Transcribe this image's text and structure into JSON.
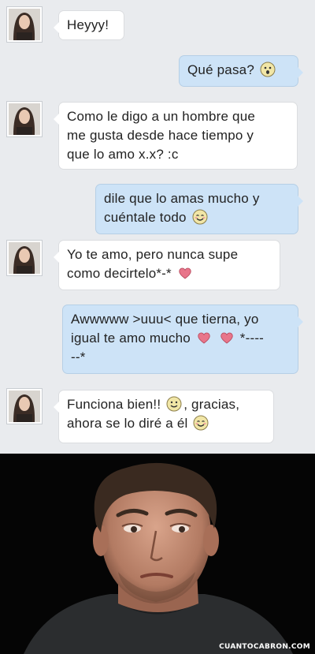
{
  "colors": {
    "chat_background": "#e9ebee",
    "incoming_bubble": "#ffffff",
    "outgoing_bubble": "#cde3f7",
    "heart": "#e8758a",
    "smiley": "#f1e6a6"
  },
  "messages": [
    {
      "side": "in",
      "text": "Heyyy!"
    },
    {
      "side": "out",
      "text": "Qué pasa?",
      "icons": [
        "surprised-emoji-icon"
      ]
    },
    {
      "side": "in",
      "line1": "Como le digo a un hombre que",
      "line2": "me gusta desde hace tiempo y",
      "line3": "que lo amo x.x? :c"
    },
    {
      "side": "out",
      "line1": "dile que lo amas mucho y",
      "line2": "cuéntale todo",
      "icons": [
        "blushing-smile-emoji-icon"
      ]
    },
    {
      "side": "in",
      "line1": "Yo te amo, pero nunca supe",
      "line2": "como decirtelo*-*",
      "icons": [
        "heart-icon"
      ]
    },
    {
      "side": "out",
      "line1": "Awwwww >uuu< que tierna, yo",
      "line2": "igual te amo mucho",
      "line2_tail": "*----",
      "line3": "--*",
      "icons": [
        "heart-icon",
        "heart-icon"
      ]
    },
    {
      "side": "in",
      "line1_pre": "Funciona bien!!",
      "line1_post": ", gracias,",
      "line2": "ahora se lo diré a él",
      "icons": [
        "smile-emoji-icon",
        "blushing-smile-emoji-icon"
      ]
    }
  ],
  "photo": {
    "watermark": "CUANTOCABRON.COM"
  }
}
